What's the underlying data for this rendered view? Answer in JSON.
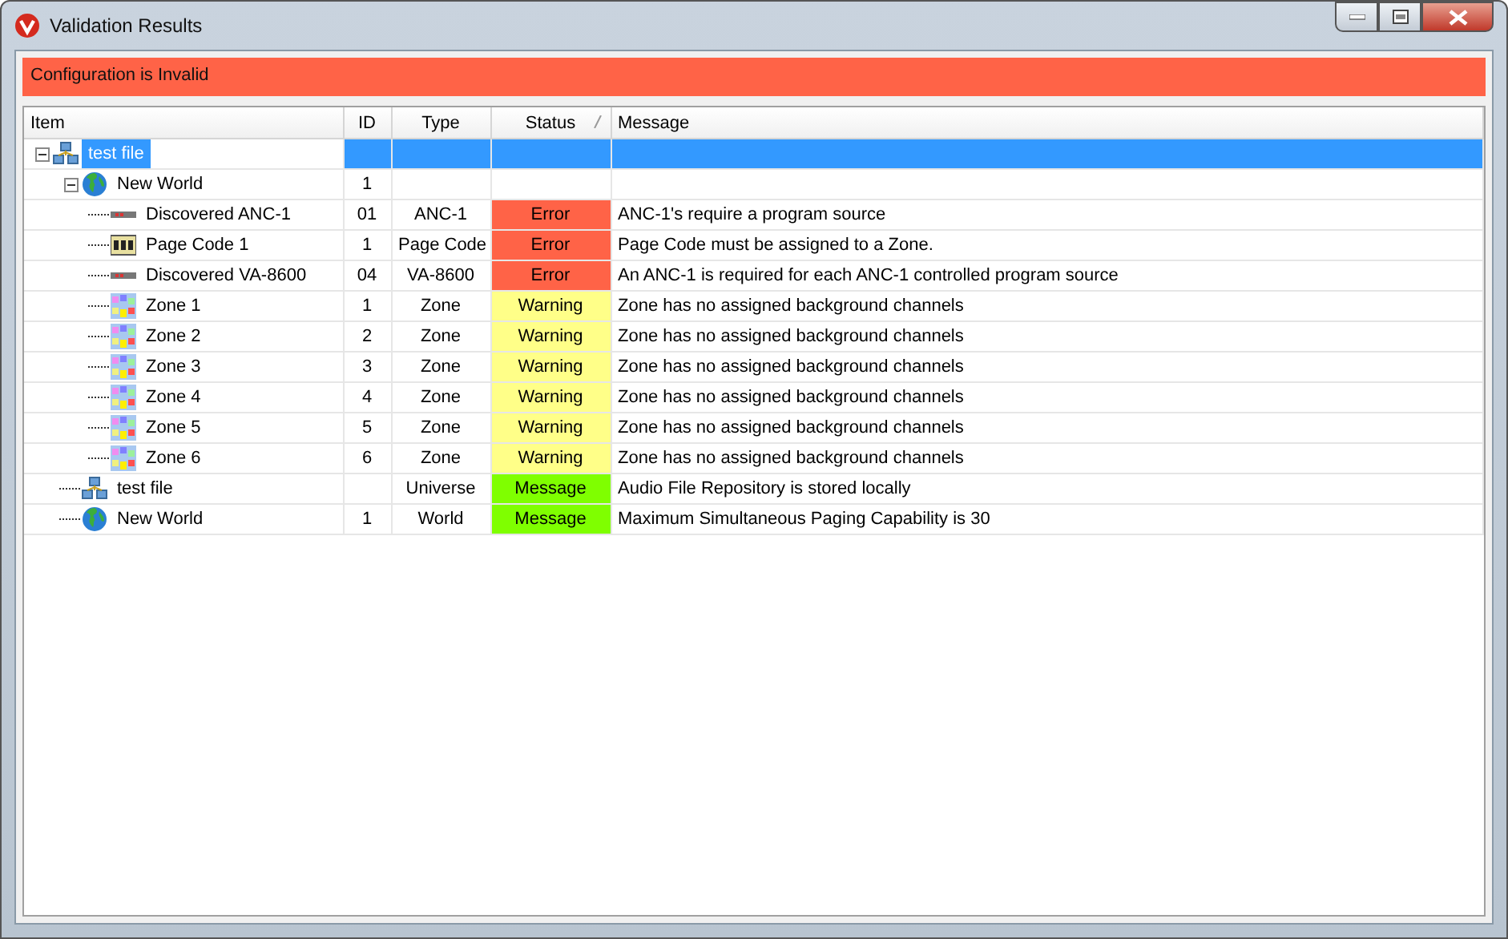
{
  "window": {
    "title": "Validation Results"
  },
  "banner": "Configuration is Invalid",
  "table": {
    "columns": [
      {
        "label": "Item",
        "sorted": false
      },
      {
        "label": "ID",
        "sorted": false
      },
      {
        "label": "Type",
        "sorted": false
      },
      {
        "label": "Status",
        "sorted": true
      },
      {
        "label": "Message",
        "sorted": false
      }
    ],
    "rows": [
      {
        "item": "test file",
        "kind": "network",
        "selected": true,
        "expanded": true,
        "children": [
          {
            "item": "New World",
            "kind": "globe",
            "id": "1",
            "selected": false,
            "expanded": true,
            "children": [
              {
                "item": "Discovered ANC-1",
                "kind": "device",
                "id": "01",
                "type": "ANC-1",
                "status": "Error",
                "color": "#ff6347",
                "message": "ANC-1's require a program source",
                "selected": false
              },
              {
                "item": "Page Code 1",
                "kind": "pagecode",
                "id": "1",
                "type": "Page Code",
                "status": "Error",
                "color": "#ff6347",
                "message": "Page Code must be assigned to a Zone.",
                "selected": false
              },
              {
                "item": "Discovered VA-8600",
                "kind": "device",
                "id": "04",
                "type": "VA-8600",
                "status": "Error",
                "color": "#ff6347",
                "message": "An ANC-1 is required for each ANC-1 controlled program source",
                "selected": false
              },
              {
                "item": "Zone 1",
                "kind": "zone",
                "id": "1",
                "type": "Zone",
                "status": "Warning",
                "color": "#ffff88",
                "message": "Zone has no assigned background channels",
                "selected": false
              },
              {
                "item": "Zone 2",
                "kind": "zone",
                "id": "2",
                "type": "Zone",
                "status": "Warning",
                "color": "#ffff88",
                "message": "Zone has no assigned background channels",
                "selected": false
              },
              {
                "item": "Zone 3",
                "kind": "zone",
                "id": "3",
                "type": "Zone",
                "status": "Warning",
                "color": "#ffff88",
                "message": "Zone has no assigned background channels",
                "selected": false
              },
              {
                "item": "Zone 4",
                "kind": "zone",
                "id": "4",
                "type": "Zone",
                "status": "Warning",
                "color": "#ffff88",
                "message": "Zone has no assigned background channels",
                "selected": false
              },
              {
                "item": "Zone 5",
                "kind": "zone",
                "id": "5",
                "type": "Zone",
                "status": "Warning",
                "color": "#ffff88",
                "message": "Zone has no assigned background channels",
                "selected": false
              },
              {
                "item": "Zone 6",
                "kind": "zone",
                "id": "6",
                "type": "Zone",
                "status": "Warning",
                "color": "#ffff88",
                "message": "Zone has no assigned background channels",
                "selected": false
              }
            ]
          },
          {
            "item": "test file",
            "kind": "network",
            "type": "Universe",
            "status": "Message",
            "color": "#7fff00",
            "message": "Audio File Repository is stored locally",
            "selected": false
          },
          {
            "item": "New World",
            "kind": "globe",
            "id": "1",
            "type": "World",
            "status": "Message",
            "color": "#7fff00",
            "message": "Maximum Simultaneous Paging Capability is 30",
            "selected": false
          }
        ]
      }
    ]
  }
}
